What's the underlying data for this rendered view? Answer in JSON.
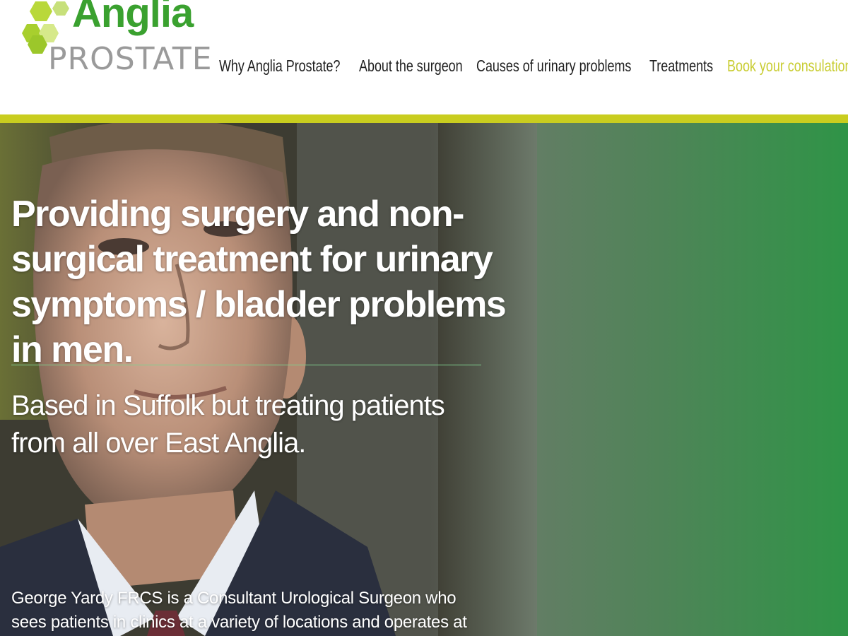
{
  "brand": {
    "name": "Anglia",
    "subname": "PROSTATE",
    "colors": {
      "green": "#3aa12f",
      "lime": "#c9cd1f",
      "grey": "#9a9a9a"
    }
  },
  "nav": {
    "items": [
      {
        "label": "Why Anglia Prostate?"
      },
      {
        "label": "About the surgeon"
      },
      {
        "label": "Causes of urinary problems"
      },
      {
        "label": "Treatments"
      },
      {
        "label": "Book your consulation"
      }
    ]
  },
  "hero": {
    "title": "Providing surgery and non-surgical treatment for urinary symptoms / bladder problems in men.",
    "subtitle": "Based in Suffolk but treating patients from all over East Anglia.",
    "body": "George Yardy FRCS is a Consultant Urological Surgeon who sees patients in clinics at a variety of locations and operates at Nuffield Health Ipswich"
  }
}
